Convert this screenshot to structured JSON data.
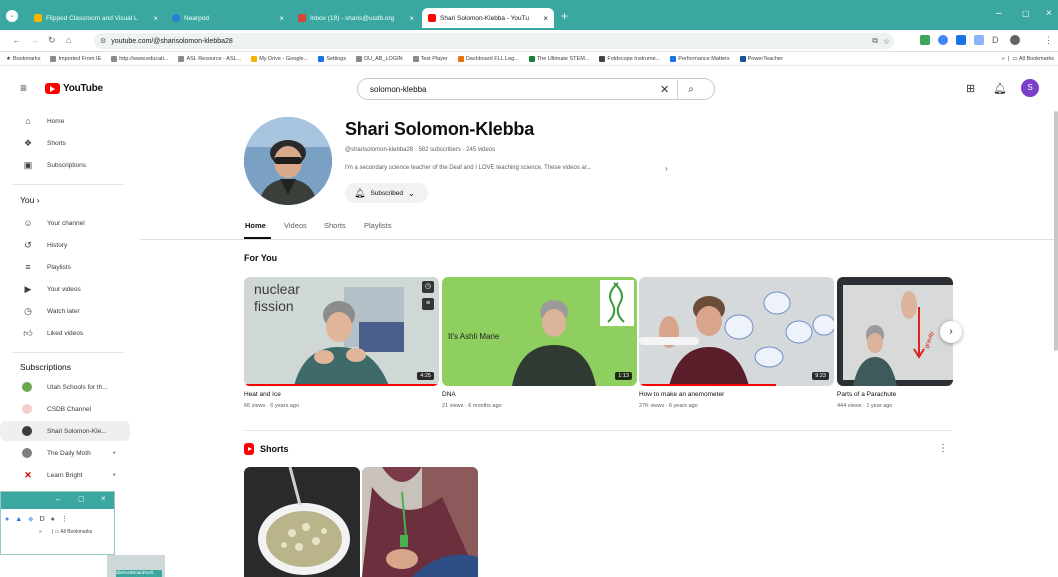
{
  "browser": {
    "tabs": [
      {
        "title": "Flipped Classroom and Visual L",
        "color": "#f4b400"
      },
      {
        "title": "Nearpod",
        "color": "#2a7fd4"
      },
      {
        "title": "Inbox (18) - sharis@usdb.org",
        "color": "#d44638"
      },
      {
        "title": "Shari Solomon-Klebba - YouTu",
        "color": "#ff0000"
      }
    ],
    "new_tab": "+",
    "url": "youtube.com/@sharisolomon-klebba28",
    "window": {
      "minimize": "–",
      "maximize": "▢",
      "close": "×"
    },
    "bookmarks_label": "Bookmarks",
    "bookmarks": [
      "Imported From IE",
      "http://www.educati...",
      "ASL Resource - ASL...",
      "My Drive - Google...",
      "Settings",
      "DU_AB_LOGIN",
      "Test Player",
      "Dashboard FLL Leg...",
      "The Ultimate STEM...",
      "Foldscope Instrume...",
      "Performance Matters",
      "PowerTeacher"
    ],
    "all_bookmarks": "All Bookmarks"
  },
  "youtube": {
    "logo_text": "YouTube",
    "search_value": "solomon-klebba",
    "avatar_letter": "S"
  },
  "sidebar": {
    "main": [
      {
        "label": "Home",
        "icon": "home-icon",
        "glyph": "⌂"
      },
      {
        "label": "Shorts",
        "icon": "shorts-icon",
        "glyph": "❖"
      },
      {
        "label": "Subscriptions",
        "icon": "subscriptions-icon",
        "glyph": "▣"
      }
    ],
    "you_heading": "You",
    "you_items": [
      {
        "label": "Your channel",
        "icon": "your-channel-icon",
        "glyph": "☺"
      },
      {
        "label": "History",
        "icon": "history-icon",
        "glyph": "↺"
      },
      {
        "label": "Playlists",
        "icon": "playlists-icon",
        "glyph": "≡"
      },
      {
        "label": "Your videos",
        "icon": "your-videos-icon",
        "glyph": "▶"
      },
      {
        "label": "Watch later",
        "icon": "watch-later-icon",
        "glyph": "◷"
      },
      {
        "label": "Liked videos",
        "icon": "liked-videos-icon",
        "glyph": "👍"
      }
    ],
    "subscriptions_heading": "Subscriptions",
    "subscriptions": [
      {
        "label": "Utah Schools for th...",
        "color": "#6aa84f",
        "dot": ""
      },
      {
        "label": "CSDB Channel",
        "color": "#e06666",
        "dot": ""
      },
      {
        "label": "Shari Solomon-Kle...",
        "color": "#3c3c3c",
        "dot": ""
      },
      {
        "label": "The Daily Moth",
        "color": "#7f7f7f",
        "dot": "•"
      },
      {
        "label": "Learn Bright",
        "color": "#cc0000",
        "dot": "•"
      }
    ]
  },
  "mini_window": {
    "controls": [
      "–",
      "▢",
      "×"
    ],
    "all_bookmarks": "All Bookmarks",
    "strip_tag": "dbs%20Board%20"
  },
  "channel": {
    "name": "Shari Solomon-Klebba",
    "meta": "@sharisolomon-klebba28 · 582 subscribers · 245 videos",
    "description": "I'm a secondary science teacher of the Deaf and I LOVE teaching science. These videos ar...",
    "more": "›",
    "subscribed_label": "Subscribed",
    "tabs": [
      "Home",
      "Videos",
      "Shorts",
      "Playlists"
    ]
  },
  "for_you": {
    "heading": "For You",
    "videos": [
      {
        "title": "Heat and Ice",
        "meta": "66 views · 6 years ago",
        "duration": "4:25",
        "overlay": "nuclear fission",
        "overlay_line1": "nuclear",
        "overlay_line2": "fission",
        "progress": 1.0
      },
      {
        "title": "DNA",
        "meta": "21 views · 6 months ago",
        "duration": "1:13",
        "overlay": "It's Ashli Marie",
        "progress": 0
      },
      {
        "title": "How to make an anemometer",
        "meta": "27K views · 6 years ago",
        "duration": "9:23",
        "overlay": "",
        "progress": 0.7
      },
      {
        "title": "Parts of a Parachute",
        "meta": "444 views · 1 year ago",
        "duration": "",
        "overlay": "gravity",
        "progress": 0
      }
    ]
  },
  "shorts": {
    "heading": "Shorts"
  }
}
